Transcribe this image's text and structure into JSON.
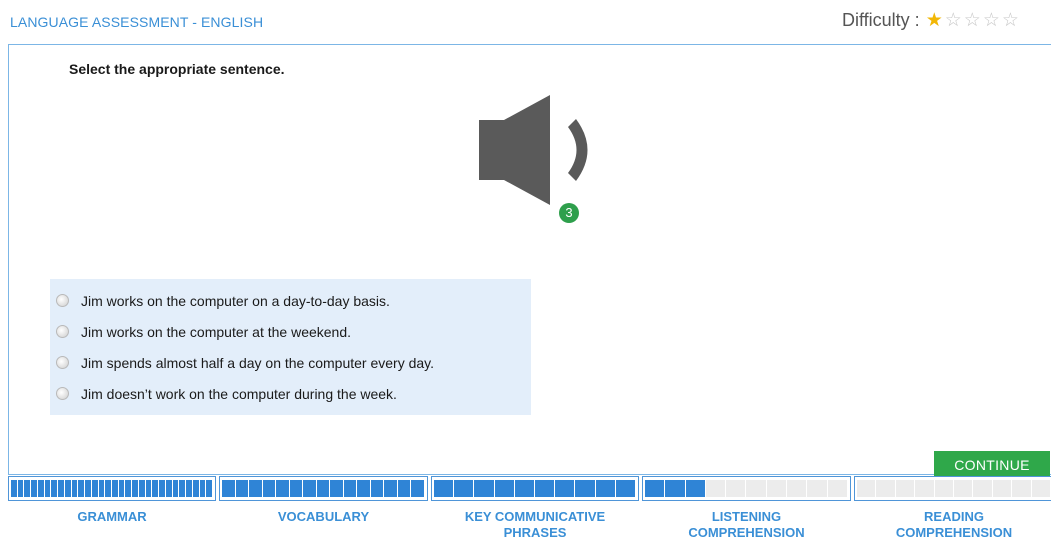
{
  "header": {
    "title": "LANGUAGE ASSESSMENT - ENGLISH",
    "difficulty_label": "Difficulty :",
    "difficulty_level": 1,
    "difficulty_max": 5
  },
  "question": {
    "instruction": "Select the appropriate sentence.",
    "audio_icon": "speaker-icon",
    "plays_remaining": "3",
    "options": [
      "Jim works on the computer on a day-to-day basis.",
      "Jim works on the computer at the weekend.",
      "Jim spends almost half a day on the computer every day.",
      "Jim doesn’t work on the computer during the week."
    ]
  },
  "actions": {
    "continue_label": "CONTINUE"
  },
  "progress": {
    "sections": [
      {
        "label_line1": "GRAMMAR",
        "label_line2": "",
        "segments": 30,
        "completed": 30
      },
      {
        "label_line1": "VOCABULARY",
        "label_line2": "",
        "segments": 15,
        "completed": 15
      },
      {
        "label_line1": "KEY COMMUNICATIVE",
        "label_line2": "PHRASES",
        "segments": 10,
        "completed": 10
      },
      {
        "label_line1": "LISTENING",
        "label_line2": "COMPREHENSION",
        "segments": 10,
        "completed": 3
      },
      {
        "label_line1": "READING",
        "label_line2": "COMPREHENSION",
        "segments": 10,
        "completed": 0
      }
    ]
  },
  "colors": {
    "accent": "#3a8fd6",
    "progress_fill": "#2f84d6",
    "continue_bg": "#2fa84a",
    "option_bg": "#e3eefa"
  }
}
